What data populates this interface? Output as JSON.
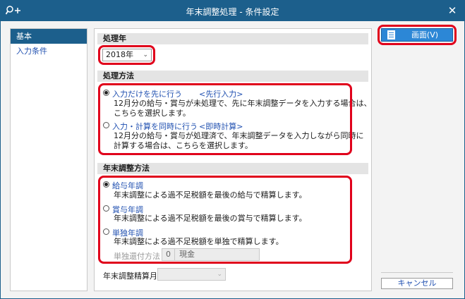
{
  "window": {
    "title": "年末調整処理 - 条件設定",
    "icon": "search-plus-icon",
    "close_icon": "close-icon"
  },
  "sidebar": {
    "items": [
      {
        "label": "基本",
        "active": true
      },
      {
        "label": "入力条件",
        "active": false
      }
    ]
  },
  "year": {
    "heading": "処理年",
    "value": "2018年"
  },
  "method": {
    "heading": "処理方法",
    "options": [
      {
        "label": "入力だけを先に行う",
        "tag": "<先行入力>",
        "checked": true,
        "desc": [
          "12月分の給与・賞与が未処理で、先に年末調整データを入力する場合は、",
          "こちらを選択します。"
        ]
      },
      {
        "label": "入力・計算を同時に行う",
        "tag": "<即時計算>",
        "checked": false,
        "desc": [
          "12月分の給与・賞与が処理済で、年末調整データを入力しながら同時に",
          "計算する場合は、こちらを選択します。"
        ]
      }
    ]
  },
  "adjust": {
    "heading": "年末調整方法",
    "options": [
      {
        "label": "給与年調",
        "checked": true,
        "desc": "年末調整による過不足税額を最後の給与で精算します。"
      },
      {
        "label": "賞与年調",
        "checked": false,
        "desc": "年末調整による過不足税額を最後の賞与で精算します。"
      },
      {
        "label": "単独年調",
        "checked": false,
        "desc": "年末調整による過不足税額を単独で精算します。"
      }
    ],
    "refund_label": "単独還付方法",
    "refund_code": "0",
    "refund_value": "現金"
  },
  "settle_month": {
    "label": "年末調整精算月",
    "value": ""
  },
  "buttons": {
    "screen": "画面(V)",
    "screen_icon": "document-icon",
    "cancel": "キャンセル"
  },
  "colors": {
    "titlebar": "#1c5f8c",
    "primary": "#2c87d6",
    "highlight": "#e0001b",
    "link": "#1f4fb0"
  }
}
